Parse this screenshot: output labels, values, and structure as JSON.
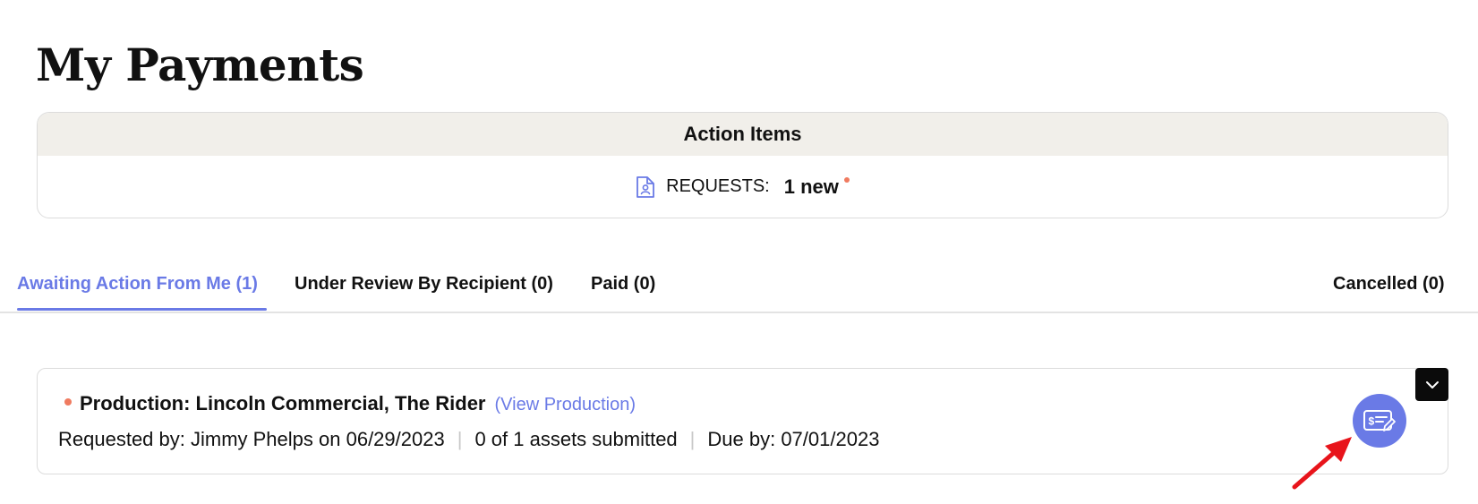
{
  "page": {
    "title": "My Payments"
  },
  "action_items": {
    "header": "Action Items",
    "requests_icon": "document-user-icon",
    "requests_label": "REQUESTS:",
    "requests_count": "1 new"
  },
  "tabs": [
    {
      "label": "Awaiting Action From Me (1)",
      "active": true
    },
    {
      "label": "Under Review By Recipient (0)",
      "active": false
    },
    {
      "label": "Paid (0)",
      "active": false
    },
    {
      "label": "Cancelled (0)",
      "active": false
    }
  ],
  "payment_item": {
    "title": "Production: Lincoln Commercial, The Rider",
    "view_link": "(View Production)",
    "requested_by": "Requested by: Jimmy Phelps on 06/29/2023",
    "assets": "0 of 1 assets submitted",
    "due": "Due by: 07/01/2023",
    "separator": "|",
    "expand_icon": "chevron-down-icon",
    "action_icon": "payment-edit-icon"
  },
  "colors": {
    "accent": "#6a7ae6",
    "notification_dot": "#f07b60",
    "header_bg": "#f1efea",
    "toggle_bg": "#0b0b0b",
    "annotation_arrow": "#e8141b"
  }
}
